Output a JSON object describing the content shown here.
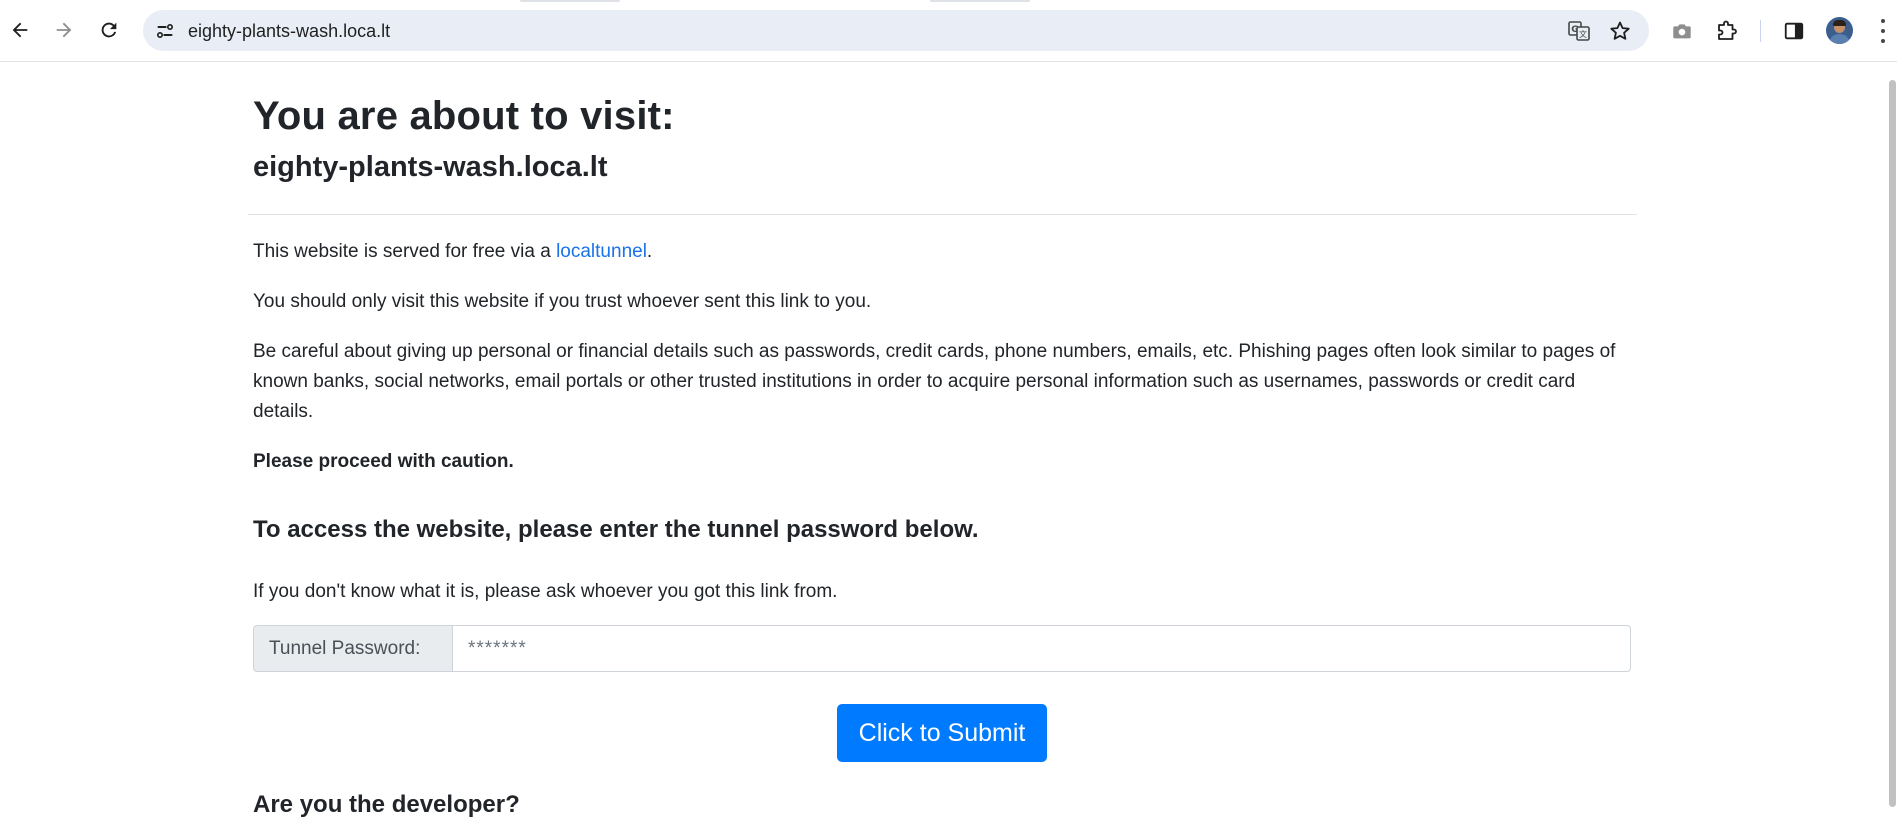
{
  "browser": {
    "url": "eighty-plants-wash.loca.lt",
    "icons": {
      "back": "arrow-left-icon",
      "forward": "arrow-right-icon",
      "reload": "reload-icon",
      "site_info": "tune-icon",
      "translate": "translate-icon",
      "bookmark": "star-icon",
      "screenshot": "camera-icon",
      "extensions": "puzzle-icon",
      "side_panel": "side-panel-icon",
      "profile": "avatar",
      "menu": "kebab-menu-icon"
    }
  },
  "page": {
    "heading": "You are about to visit:",
    "host": "eighty-plants-wash.loca.lt",
    "intro_prefix": "This website is served for free via a ",
    "intro_link": "localtunnel",
    "intro_suffix": ".",
    "trust_text": "You should only visit this website if you trust whoever sent this link to you.",
    "warning_text": "Be careful about giving up personal or financial details such as passwords, credit cards, phone numbers, emails, etc. Phishing pages often look similar to pages of known banks, social networks, email portals or other trusted institutions in order to acquire personal information such as usernames, passwords or credit card details.",
    "caution_text": "Please proceed with caution.",
    "access_heading": "To access the website, please enter the tunnel password below.",
    "hint_text": "If you don't know what it is, please ask whoever you got this link from.",
    "password_label": "Tunnel Password:",
    "password_placeholder": "*******",
    "submit_label": "Click to Submit",
    "developer_heading": "Are you the developer?"
  },
  "colors": {
    "link": "#1a73e8",
    "button": "#007bff",
    "text": "#212529"
  }
}
